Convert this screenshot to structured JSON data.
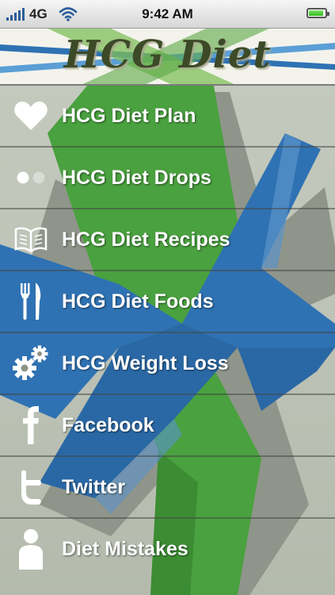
{
  "status_bar": {
    "carrier": "4G",
    "time": "9:42 AM",
    "battery_level": 0.9
  },
  "header": {
    "title": "HCG Diet"
  },
  "menu": {
    "items": [
      {
        "label": "HCG Diet Plan",
        "icon": "heart-icon"
      },
      {
        "label": "HCG Diet Drops",
        "icon": "drops-icon"
      },
      {
        "label": "HCG Diet Recipes",
        "icon": "book-icon"
      },
      {
        "label": "HCG Diet Foods",
        "icon": "fork-knife-icon"
      },
      {
        "label": "HCG Weight Loss",
        "icon": "gears-icon"
      },
      {
        "label": "Facebook",
        "icon": "facebook-icon"
      },
      {
        "label": "Twitter",
        "icon": "twitter-icon"
      },
      {
        "label": "Diet Mistakes",
        "icon": "person-icon"
      }
    ]
  },
  "colors": {
    "background": "#b9bfb4",
    "x_blue": "#2f72b3",
    "x_green": "#4aa13f",
    "label": "#ffffff"
  }
}
